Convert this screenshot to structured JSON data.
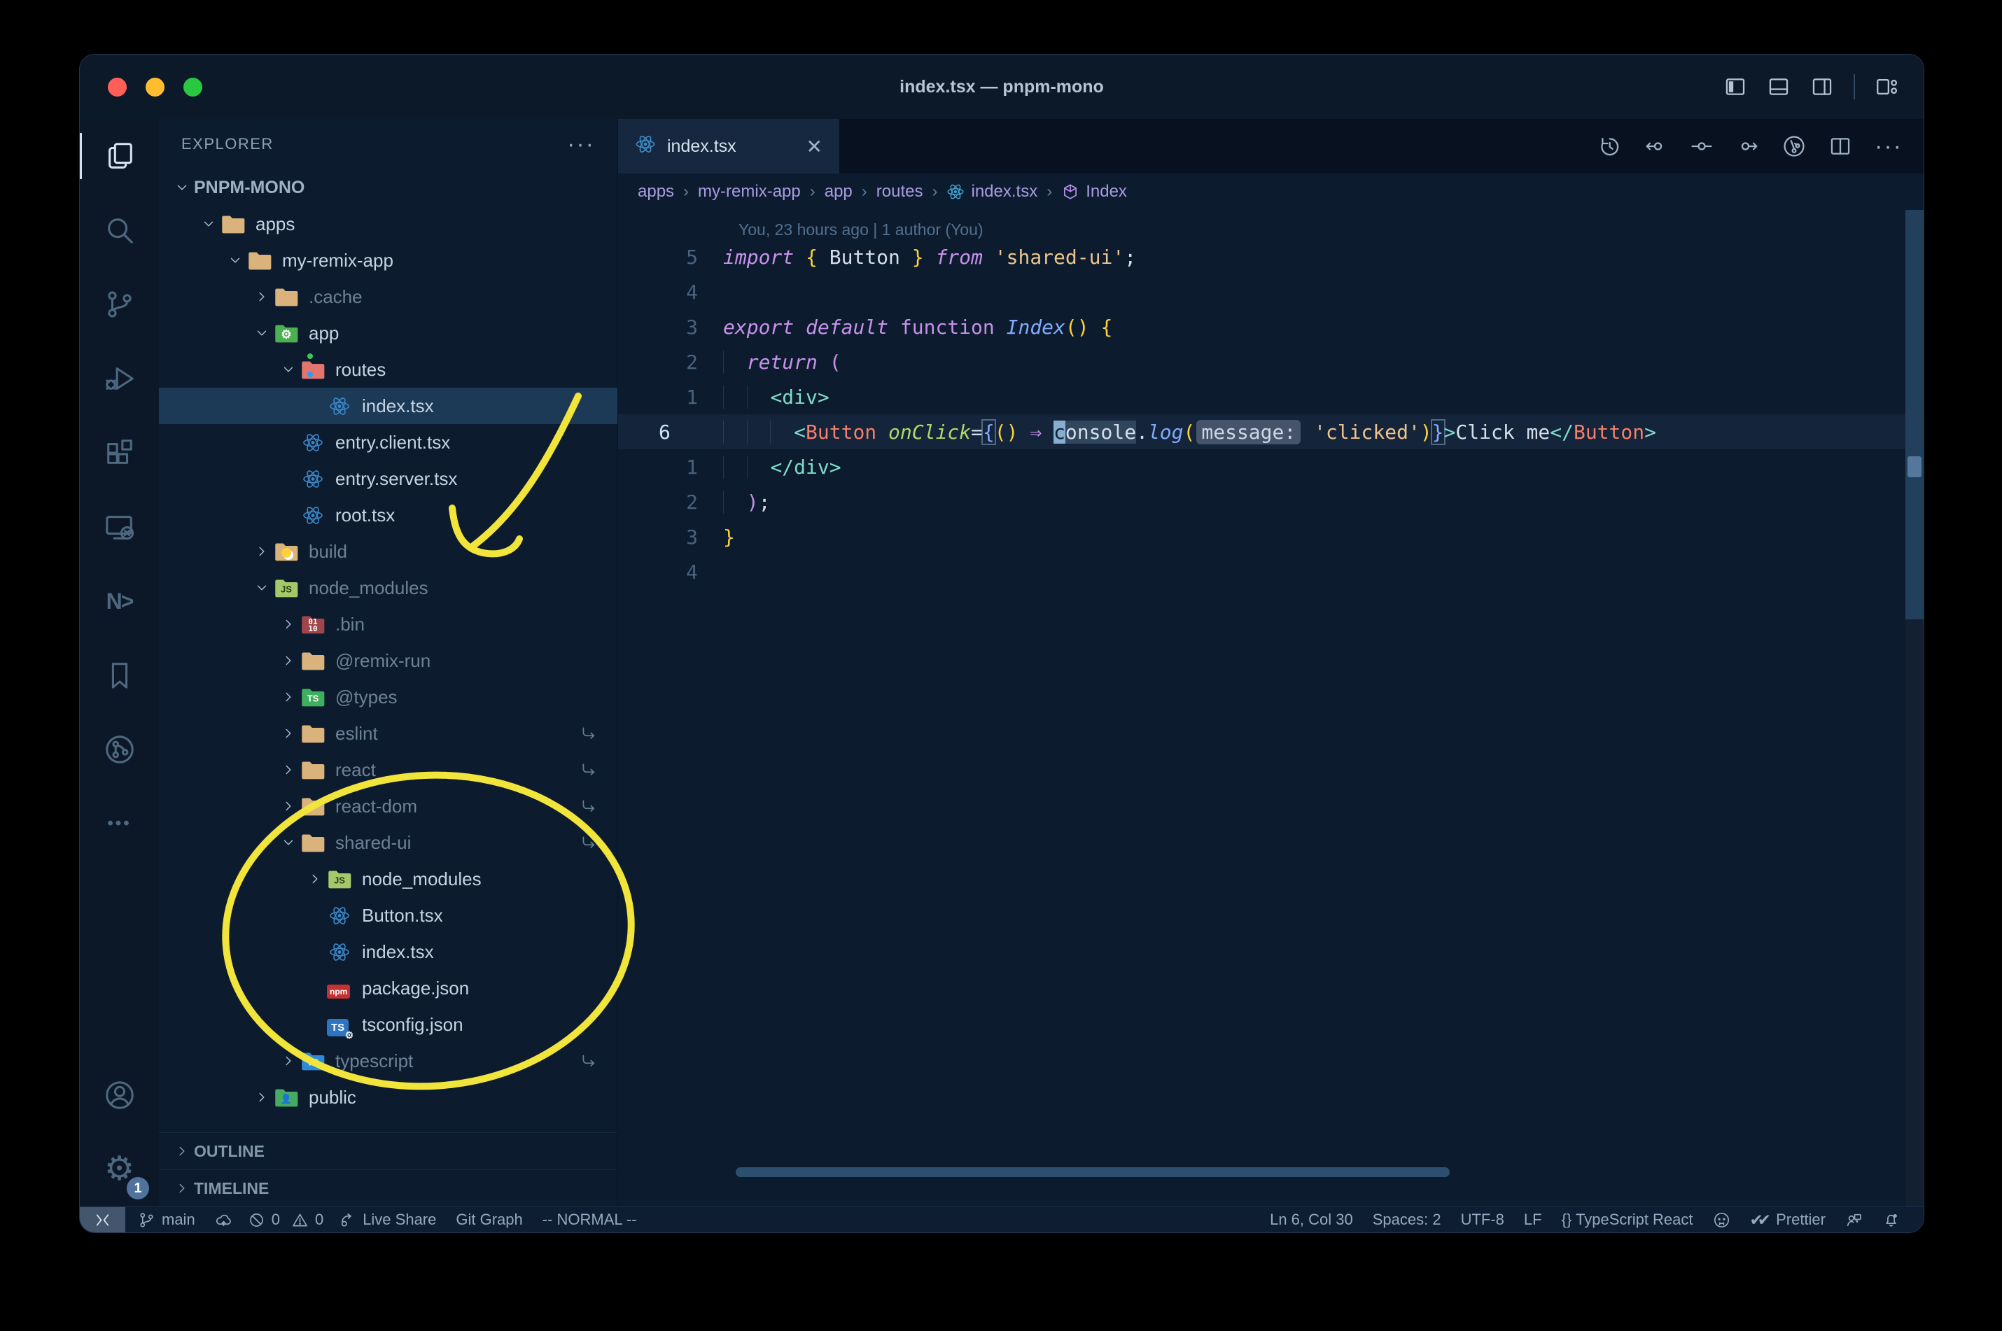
{
  "theme": {
    "accent_yellow": "#f1e43b",
    "selection_bg": "#1c3a56",
    "editor_bg": "#0d1b2e",
    "traffic_lights": [
      "#ff5f57",
      "#febc2e",
      "#28c840"
    ]
  },
  "titlebar": {
    "title": "index.tsx — pnpm-mono",
    "right_icons": [
      "toggle-sidebar-icon",
      "toggle-panel-icon",
      "toggle-secondary-sidebar-icon",
      "customize-layout-icon"
    ]
  },
  "activity_bar": {
    "top": [
      {
        "name": "explorer",
        "icon": "files-icon",
        "active": true
      },
      {
        "name": "search",
        "icon": "search-icon"
      },
      {
        "name": "source-control",
        "icon": "git-branch-icon"
      },
      {
        "name": "run-debug",
        "icon": "debug-icon"
      },
      {
        "name": "extensions",
        "icon": "extensions-icon"
      },
      {
        "name": "remote-explorer",
        "icon": "remote-explorer-icon"
      },
      {
        "name": "nx-console",
        "icon": "nx-icon",
        "text": "N>"
      },
      {
        "name": "bookmarks",
        "icon": "bookmark-icon"
      },
      {
        "name": "git-graph",
        "icon": "git-graph-icon"
      },
      {
        "name": "more-views",
        "icon": "more-icon",
        "text": "•••"
      }
    ],
    "bottom": [
      {
        "name": "accounts",
        "icon": "account-icon"
      },
      {
        "name": "settings",
        "icon": "gear-icon",
        "text": "⚙",
        "badge": "1"
      }
    ]
  },
  "explorer": {
    "header": "EXPLORER",
    "more_label": "···",
    "root": "PNPM-MONO",
    "tree": [
      {
        "label": "apps",
        "depth": 1,
        "chevron": "down",
        "icon": "folder"
      },
      {
        "label": "my-remix-app",
        "depth": 2,
        "chevron": "down",
        "icon": "folder"
      },
      {
        "label": ".cache",
        "depth": 3,
        "chevron": "right",
        "icon": "folder",
        "dim": true
      },
      {
        "label": "app",
        "depth": 3,
        "chevron": "down",
        "icon": "folder-app"
      },
      {
        "label": "routes",
        "depth": 4,
        "chevron": "down",
        "icon": "folder-routes"
      },
      {
        "label": "index.tsx",
        "depth": 5,
        "chevron": "none",
        "icon": "react",
        "selected": true
      },
      {
        "label": "entry.client.tsx",
        "depth": 4,
        "chevron": "none",
        "icon": "react"
      },
      {
        "label": "entry.server.tsx",
        "depth": 4,
        "chevron": "none",
        "icon": "react"
      },
      {
        "label": "root.tsx",
        "depth": 4,
        "chevron": "none",
        "icon": "react"
      },
      {
        "label": "build",
        "depth": 3,
        "chevron": "right",
        "icon": "folder-build",
        "dim": true
      },
      {
        "label": "node_modules",
        "depth": 3,
        "chevron": "down",
        "icon": "folder-node",
        "dim": true
      },
      {
        "label": ".bin",
        "depth": 4,
        "chevron": "right",
        "icon": "folder-binary",
        "dim": true
      },
      {
        "label": "@remix-run",
        "depth": 4,
        "chevron": "right",
        "icon": "folder",
        "dim": true
      },
      {
        "label": "@types",
        "depth": 4,
        "chevron": "right",
        "icon": "folder-types",
        "dim": true
      },
      {
        "label": "eslint",
        "depth": 4,
        "chevron": "right",
        "icon": "folder",
        "dim": true,
        "symlink": true
      },
      {
        "label": "react",
        "depth": 4,
        "chevron": "right",
        "icon": "folder",
        "dim": true,
        "symlink": true
      },
      {
        "label": "react-dom",
        "depth": 4,
        "chevron": "right",
        "icon": "folder",
        "dim": true,
        "symlink": true
      },
      {
        "label": "shared-ui",
        "depth": 4,
        "chevron": "down",
        "icon": "folder",
        "dim": true,
        "symlink": true
      },
      {
        "label": "node_modules",
        "depth": 5,
        "chevron": "right",
        "icon": "folder-node"
      },
      {
        "label": "Button.tsx",
        "depth": 5,
        "chevron": "none",
        "icon": "react"
      },
      {
        "label": "index.tsx",
        "depth": 5,
        "chevron": "none",
        "icon": "react"
      },
      {
        "label": "package.json",
        "depth": 5,
        "chevron": "none",
        "icon": "npm"
      },
      {
        "label": "tsconfig.json",
        "depth": 5,
        "chevron": "none",
        "icon": "tsconfig"
      },
      {
        "label": "typescript",
        "depth": 4,
        "chevron": "right",
        "icon": "folder-ts",
        "dim": true,
        "symlink": true
      },
      {
        "label": "public",
        "depth": 3,
        "chevron": "right",
        "icon": "folder-public"
      }
    ],
    "sections": [
      {
        "label": "OUTLINE"
      },
      {
        "label": "TIMELINE"
      }
    ]
  },
  "tab": {
    "label": "index.tsx",
    "icon": "react-icon",
    "close": "✕"
  },
  "editor_actions": [
    "history-icon",
    "prev-change-icon",
    "change-icon",
    "next-change-icon",
    "gitlens-icon",
    "split-editor-icon",
    "more-actions-icon"
  ],
  "breadcrumbs": [
    {
      "label": "apps"
    },
    {
      "label": "my-remix-app"
    },
    {
      "label": "app"
    },
    {
      "label": "routes"
    },
    {
      "label": "index.tsx",
      "icon": "react"
    },
    {
      "label": "Index",
      "icon": "symbol-cube"
    }
  ],
  "editor": {
    "blame": "You, 23 hours ago | 1 author (You)",
    "lines": [
      {
        "g": "5",
        "tokens": [
          [
            "import ",
            "k"
          ],
          [
            "{",
            "y"
          ],
          [
            " Button ",
            "w"
          ],
          [
            "}",
            "y"
          ],
          [
            " ",
            "w"
          ],
          [
            "from",
            "k"
          ],
          [
            " ",
            "w"
          ],
          [
            "'shared-ui'",
            "s"
          ],
          [
            ";",
            "w"
          ]
        ]
      },
      {
        "g": "4",
        "tokens": []
      },
      {
        "g": "3",
        "tokens": [
          [
            "export",
            "k"
          ],
          [
            " ",
            "w"
          ],
          [
            "default",
            "k"
          ],
          [
            " ",
            "w"
          ],
          [
            "function",
            "K"
          ],
          [
            " ",
            "w"
          ],
          [
            "Index",
            "f"
          ],
          [
            "()",
            "y"
          ],
          [
            " ",
            "w"
          ],
          [
            "{",
            "y"
          ]
        ]
      },
      {
        "g": "2",
        "tokens": [
          [
            "  ",
            "i"
          ],
          [
            "return",
            "k"
          ],
          [
            " ",
            "w"
          ],
          [
            "(",
            "m"
          ]
        ]
      },
      {
        "g": "1",
        "tokens": [
          [
            "  ",
            "i"
          ],
          [
            "  ",
            "i"
          ],
          [
            "<div>",
            "t"
          ]
        ]
      },
      {
        "g": "6",
        "current": true,
        "tokens": [
          [
            "  ",
            "i"
          ],
          [
            "  ",
            "i"
          ],
          [
            "  ",
            "i"
          ],
          [
            "<",
            "t"
          ],
          [
            "Button",
            "c"
          ],
          [
            " ",
            "w"
          ],
          [
            "onClick",
            "g"
          ],
          [
            "=",
            "w"
          ],
          [
            "{",
            "b M"
          ],
          [
            "()",
            "y"
          ],
          [
            " ",
            "w"
          ],
          [
            "⇒",
            "m"
          ],
          [
            " ",
            "w"
          ],
          [
            "c",
            "C"
          ],
          [
            "onsole",
            "w H"
          ],
          [
            ".",
            "w"
          ],
          [
            "log",
            "f"
          ],
          [
            "(",
            "y"
          ],
          [
            "message:",
            "I"
          ],
          [
            " ",
            "w"
          ],
          [
            "'clicked'",
            "s"
          ],
          [
            ")",
            "y"
          ],
          [
            "}",
            "b M"
          ],
          [
            ">",
            "t"
          ],
          [
            "Click me",
            "w"
          ],
          [
            "</",
            "t"
          ],
          [
            "Button",
            "c"
          ],
          [
            ">",
            "t"
          ]
        ]
      },
      {
        "g": "1",
        "tokens": [
          [
            "  ",
            "i"
          ],
          [
            "  ",
            "i"
          ],
          [
            "</div>",
            "t"
          ]
        ]
      },
      {
        "g": "2",
        "tokens": [
          [
            "  ",
            "i"
          ],
          [
            ")",
            "m"
          ],
          [
            ";",
            "w"
          ]
        ]
      },
      {
        "g": "3",
        "tokens": [
          [
            "}",
            "y"
          ]
        ]
      },
      {
        "g": "4",
        "tokens": []
      }
    ]
  },
  "status_bar": {
    "left": [
      {
        "icon": "remote-icon",
        "label": "",
        "kind": "remote"
      },
      {
        "icon": "git-branch-icon",
        "label": "main"
      },
      {
        "icon": "cloud-upload-icon",
        "label": ""
      },
      {
        "icon": "error-icon",
        "label": "0",
        "kind": "tight"
      },
      {
        "icon": "warning-icon",
        "label": "0",
        "kind": "tight"
      },
      {
        "icon": "live-share-icon",
        "label": "Live Share"
      },
      {
        "icon": "",
        "label": "Git Graph"
      },
      {
        "icon": "",
        "label": "-- NORMAL --"
      }
    ],
    "right": [
      {
        "icon": "",
        "label": "Ln 6, Col 30"
      },
      {
        "icon": "",
        "label": "Spaces: 2"
      },
      {
        "icon": "",
        "label": "UTF-8"
      },
      {
        "icon": "",
        "label": "LF"
      },
      {
        "icon": "",
        "label": "{} TypeScript React"
      },
      {
        "icon": "octoface-icon",
        "label": ""
      },
      {
        "icon": "double-check-icon",
        "label": "Prettier"
      },
      {
        "icon": "feedback-icon",
        "label": ""
      },
      {
        "icon": "bell-dot-icon",
        "label": ""
      }
    ]
  },
  "annotations": {
    "color": "#f1e43b",
    "shapes": [
      "arrow-to-node-modules",
      "circle-around-shared-ui"
    ]
  }
}
